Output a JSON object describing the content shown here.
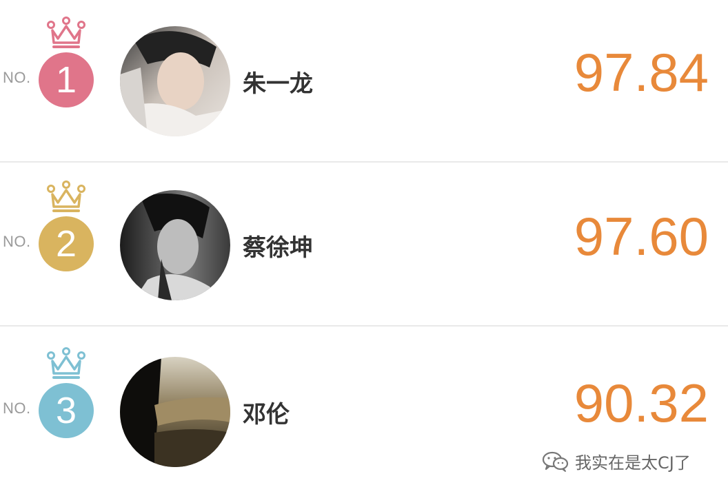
{
  "rankings": [
    {
      "no_label": "NO.",
      "rank": "1",
      "name": "朱一龙",
      "score": "97.84",
      "badge_color": "#e0758a",
      "crown_icon": "crown-icon",
      "avatar_icon": "portrait-photo"
    },
    {
      "no_label": "NO.",
      "rank": "2",
      "name": "蔡徐坤",
      "score": "97.60",
      "badge_color": "#d9b45f",
      "crown_icon": "crown-icon",
      "avatar_icon": "portrait-photo"
    },
    {
      "no_label": "NO.",
      "rank": "3",
      "name": "邓伦",
      "score": "90.32",
      "badge_color": "#7ec0d3",
      "crown_icon": "crown-icon",
      "avatar_icon": "portrait-photo"
    }
  ],
  "colors": {
    "score": "#e8893a",
    "name": "#333333",
    "no_label": "#9a9a9a",
    "divider": "#e9e9e9"
  },
  "watermark": {
    "icon": "wechat-icon",
    "text": "我实在是太CJ了"
  }
}
